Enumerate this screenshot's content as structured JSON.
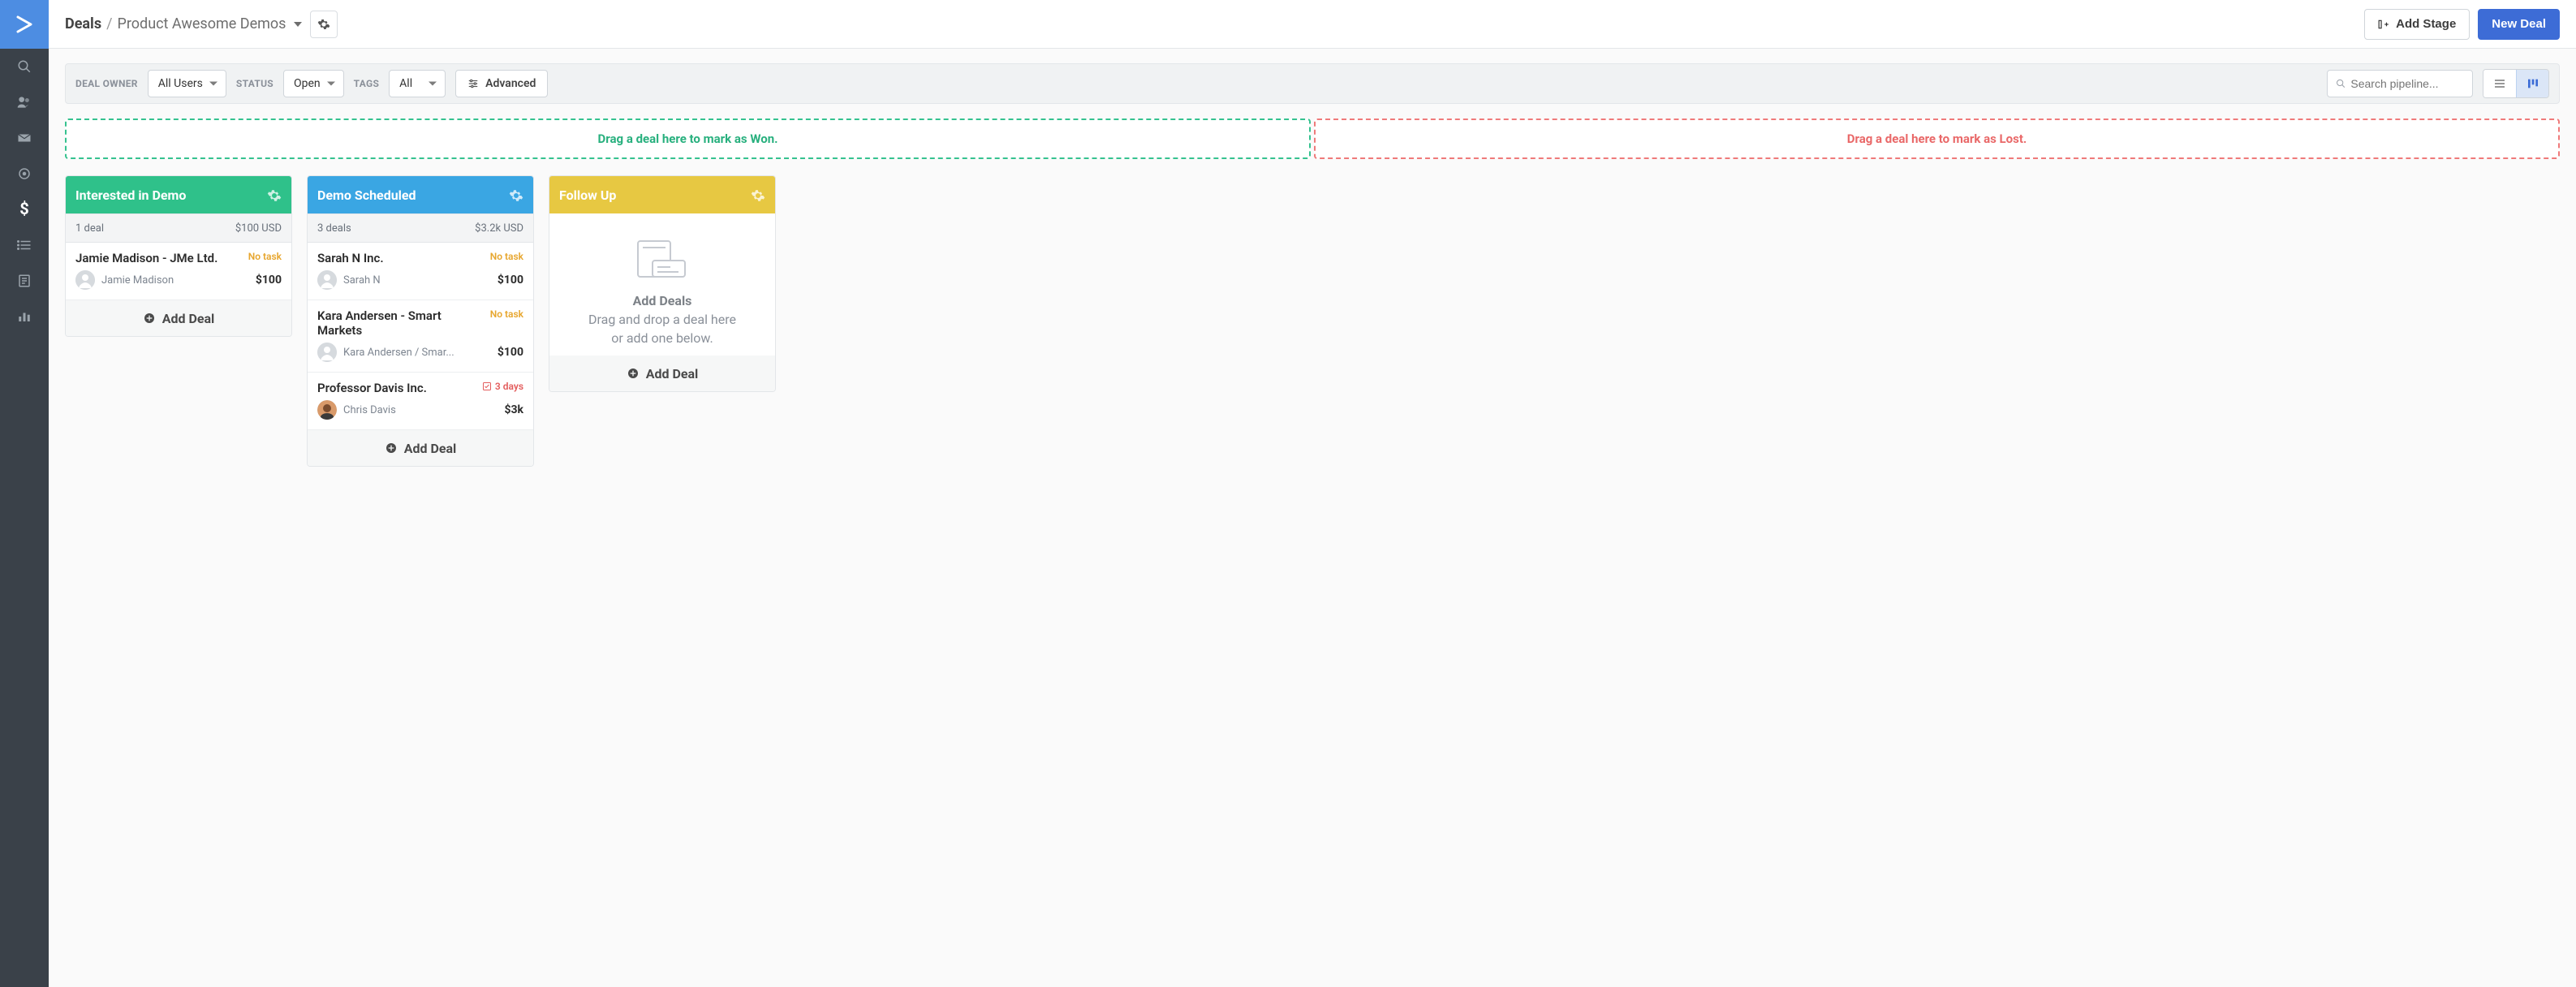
{
  "breadcrumb": {
    "root": "Deals",
    "current": "Product Awesome Demos"
  },
  "topbar": {
    "add_stage": "Add Stage",
    "new_deal": "New Deal"
  },
  "filters": {
    "owner_label": "DEAL OWNER",
    "owner_value": "All Users",
    "status_label": "STATUS",
    "status_value": "Open",
    "tags_label": "TAGS",
    "tags_value": "All",
    "advanced": "Advanced"
  },
  "search": {
    "placeholder": "Search pipeline..."
  },
  "dropzones": {
    "won": "Drag a deal here to mark as Won.",
    "lost": "Drag a deal here to mark as Lost."
  },
  "stages": [
    {
      "name": "Interested in Demo",
      "color": "head-green",
      "count_text": "1 deal",
      "total_text": "$100 USD",
      "deals": [
        {
          "title": "Jamie Madison - JMe Ltd.",
          "badge_text": "No task",
          "badge_style": "yellow",
          "badge_icon": "none",
          "contact": "Jamie Madison",
          "amount": "$100",
          "avatar": "default"
        }
      ],
      "add_label": "Add Deal"
    },
    {
      "name": "Demo Scheduled",
      "color": "head-blue",
      "count_text": "3 deals",
      "total_text": "$3.2k USD",
      "deals": [
        {
          "title": "Sarah N Inc.",
          "badge_text": "No task",
          "badge_style": "yellow",
          "badge_icon": "none",
          "contact": "Sarah N",
          "amount": "$100",
          "avatar": "default"
        },
        {
          "title": "Kara Andersen - Smart Markets",
          "badge_text": "No task",
          "badge_style": "yellow",
          "badge_icon": "none",
          "contact": "Kara Andersen / Smar...",
          "amount": "$100",
          "avatar": "default"
        },
        {
          "title": "Professor Davis Inc.",
          "badge_text": "3 days",
          "badge_style": "red",
          "badge_icon": "check",
          "contact": "Chris Davis",
          "amount": "$3k",
          "avatar": "photo"
        }
      ],
      "add_label": "Add Deal"
    },
    {
      "name": "Follow Up",
      "color": "head-yellow",
      "empty": {
        "title": "Add Deals",
        "line1": "Drag and drop a deal here",
        "line2": "or add one below."
      },
      "add_label": "Add Deal"
    }
  ]
}
